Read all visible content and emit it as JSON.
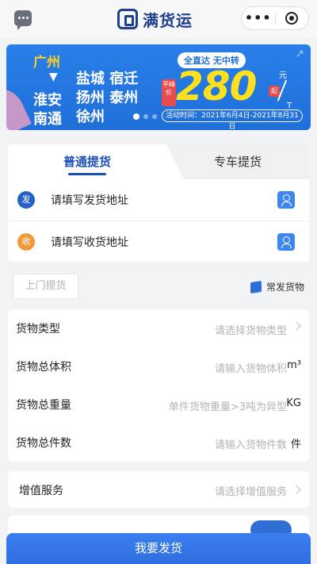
{
  "header": {
    "brand": "满货运",
    "more_icon": "ellipsis-icon",
    "close_icon": "target-icon"
  },
  "banner": {
    "origin": "广州",
    "destinations_left": [
      "淮安",
      "南通"
    ],
    "destinations_grid": [
      "盐城",
      "宿迁",
      "扬州",
      "泰州",
      "徐州"
    ],
    "tag": "全直达 无中转",
    "badge": "平峰价",
    "price": "280",
    "unit_top": "元",
    "unit_bottom": "T",
    "corner_label": "起",
    "date": "活动时间：2021年6月4日-2021年8月31日",
    "slide_count": 3,
    "active_slide": 1
  },
  "tabs": {
    "active": "普通提货",
    "other": "专车提货"
  },
  "address": {
    "send_badge": "发",
    "send_placeholder": "请填写发货地址",
    "recv_badge": "收",
    "recv_placeholder": "请填写收货地址"
  },
  "pickup": {
    "door_pickup": "上门提货",
    "frequent_goods": "常发货物"
  },
  "form": {
    "rows": [
      {
        "label": "货物类型",
        "placeholder": "请选择货物类型",
        "suffix": ">"
      },
      {
        "label": "货物总体积",
        "placeholder": "请输入货物体积",
        "suffix": "m³"
      },
      {
        "label": "货物总重量",
        "placeholder": "单件货物重量>3吨为异型",
        "suffix": "KG"
      },
      {
        "label": "货物总件数",
        "placeholder": "请输入货物件数",
        "suffix": "件"
      }
    ]
  },
  "value_added": {
    "label": "增值服务",
    "placeholder": "请选择增值服务"
  },
  "submit": {
    "label": "我要发货"
  },
  "colors": {
    "primary": "#2f6ee0",
    "brand": "#1d3f8f",
    "price": "#ffe01c",
    "send_dot": "#2461c9",
    "recv_dot": "#f29a3b"
  }
}
